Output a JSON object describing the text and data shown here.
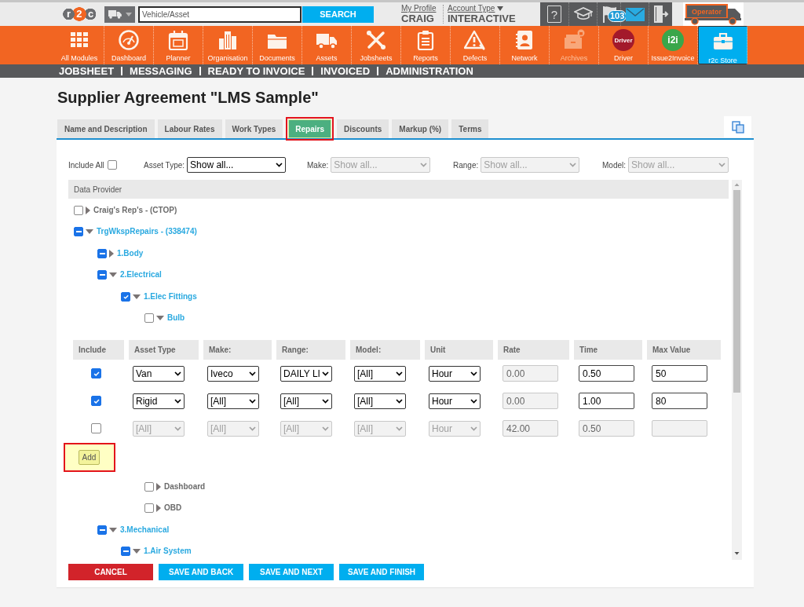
{
  "header": {
    "logo": "r2c",
    "search": {
      "placeholder": "Vehicle/Asset",
      "button": "SEARCH"
    },
    "profile": {
      "link": "My Profile",
      "value": "CRAIG"
    },
    "account": {
      "link": "Account Type",
      "value": "INTERACTIVE"
    },
    "help": "?",
    "notifications": "103",
    "role": "Operator"
  },
  "modules": [
    {
      "label": "All Modules",
      "selected": false,
      "disabled": false
    },
    {
      "label": "Dashboard",
      "selected": false,
      "disabled": false
    },
    {
      "label": "Planner",
      "selected": false,
      "disabled": false
    },
    {
      "label": "Organisation",
      "selected": false,
      "disabled": false
    },
    {
      "label": "Documents",
      "selected": false,
      "disabled": false
    },
    {
      "label": "Assets",
      "selected": false,
      "disabled": false
    },
    {
      "label": "Jobsheets",
      "selected": false,
      "disabled": false
    },
    {
      "label": "Reports",
      "selected": false,
      "disabled": false
    },
    {
      "label": "Defects",
      "selected": false,
      "disabled": false
    },
    {
      "label": "Network",
      "selected": false,
      "disabled": false
    },
    {
      "label": "Archives",
      "selected": false,
      "disabled": true
    },
    {
      "label": "Driver",
      "selected": false,
      "disabled": false,
      "logo": "Driver",
      "color": "#a3192b"
    },
    {
      "label": "Issue2Invoice",
      "selected": false,
      "disabled": false,
      "logo": "i2i",
      "color": "#3aa64a"
    },
    {
      "label": "r2c Store",
      "selected": true,
      "disabled": false
    }
  ],
  "subnav": [
    "JOBSHEET",
    "MESSAGING",
    "READY TO INVOICE",
    "INVOICED",
    "ADMINISTRATION"
  ],
  "page": {
    "title": "Supplier Agreement \"LMS Sample\"",
    "tabs": [
      {
        "label": "Name and Description",
        "selected": false,
        "highlighted": false
      },
      {
        "label": "Labour Rates",
        "selected": false,
        "highlighted": false
      },
      {
        "label": "Work Types",
        "selected": false,
        "highlighted": false
      },
      {
        "label": "Repairs",
        "selected": true,
        "highlighted": true
      },
      {
        "label": "Discounts",
        "selected": false,
        "highlighted": false
      },
      {
        "label": "Markup (%)",
        "selected": false,
        "highlighted": false
      },
      {
        "label": "Terms",
        "selected": false,
        "highlighted": false
      }
    ],
    "filters": {
      "include_all": {
        "label": "Include All",
        "checked": false
      },
      "selects": [
        {
          "label": "Asset Type:",
          "value": "Show all...",
          "disabled": false
        },
        {
          "label": "Make:",
          "value": "Show all...",
          "disabled": true
        },
        {
          "label": "Range:",
          "value": "Show all...",
          "disabled": true
        },
        {
          "label": "Model:",
          "value": "Show all...",
          "disabled": true
        }
      ]
    },
    "tree": {
      "header": "Data Provider",
      "items": [
        {
          "label": "Craig's Rep's - (CTOP)",
          "checked": false,
          "partial": false,
          "expanded": false
        },
        {
          "label": "TrgWkspRepairs - (338474)",
          "checked": false,
          "partial": true,
          "expanded": true,
          "children": [
            {
              "label": "1.Body",
              "checked": false,
              "partial": true,
              "expanded": false
            },
            {
              "label": "2.Electrical",
              "checked": false,
              "partial": true,
              "expanded": true,
              "children": [
                {
                  "label": "1.Elec Fittings",
                  "checked": true,
                  "partial": false,
                  "expanded": true,
                  "children": [
                    {
                      "label": "Bulb",
                      "checked": false,
                      "partial": false,
                      "expanded": true,
                      "rates": {
                        "columns": [
                          {
                            "label": "Include",
                            "kind": "check"
                          },
                          {
                            "label": "Asset Type",
                            "kind": "select"
                          },
                          {
                            "label": "Make:",
                            "kind": "select"
                          },
                          {
                            "label": "Range:",
                            "kind": "select"
                          },
                          {
                            "label": "Model:",
                            "kind": "select"
                          },
                          {
                            "label": "Unit",
                            "kind": "select"
                          },
                          {
                            "label": "Rate",
                            "kind": "input",
                            "readonly": true
                          },
                          {
                            "label": "Time",
                            "kind": "input",
                            "readonly": false
                          },
                          {
                            "label": "Max Value",
                            "kind": "input",
                            "readonly": false
                          }
                        ],
                        "rows": [
                          {
                            "include": true,
                            "disabled": false,
                            "selects": [
                              "Van",
                              "Iveco",
                              "DAILY LI",
                              "[All]",
                              "Hour"
                            ],
                            "inputs": [
                              "0.00",
                              "0.50",
                              "50"
                            ]
                          },
                          {
                            "include": true,
                            "disabled": false,
                            "selects": [
                              "Rigid",
                              "[All]",
                              "[All]",
                              "[All]",
                              "Hour"
                            ],
                            "inputs": [
                              "0.00",
                              "1.00",
                              "80"
                            ]
                          },
                          {
                            "include": false,
                            "disabled": true,
                            "selects": [
                              "[All]",
                              "[All]",
                              "[All]",
                              "[All]",
                              "Hour"
                            ],
                            "inputs": [
                              "42.00",
                              "0.50"
                            ]
                          }
                        ],
                        "add_button": {
                          "label": "Add",
                          "highlighted": true
                        }
                      }
                    },
                    {
                      "label": "Dashboard",
                      "checked": false,
                      "partial": false,
                      "expanded": false
                    },
                    {
                      "label": "OBD",
                      "checked": false,
                      "partial": false,
                      "expanded": false
                    }
                  ]
                }
              ]
            },
            {
              "label": "3.Mechanical",
              "checked": false,
              "partial": true,
              "expanded": true,
              "children": [
                {
                  "label": "1.Air System",
                  "checked": false,
                  "partial": true,
                  "expanded": true
                }
              ]
            }
          ]
        }
      ]
    },
    "buttons": [
      {
        "label": "CANCEL",
        "kind": "danger"
      },
      {
        "label": "SAVE AND BACK",
        "kind": "primary"
      },
      {
        "label": "SAVE AND NEXT",
        "kind": "primary"
      },
      {
        "label": "SAVE AND FINISH",
        "kind": "primary"
      }
    ]
  }
}
